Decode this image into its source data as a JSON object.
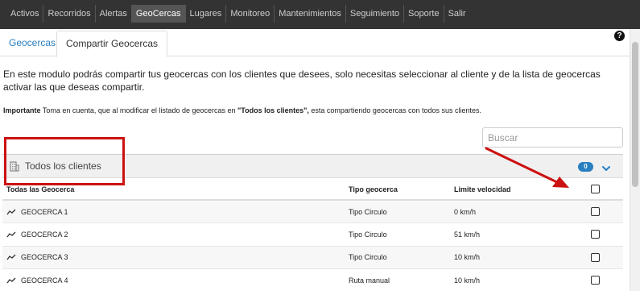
{
  "nav": {
    "items": [
      {
        "label": "Activos",
        "active": false
      },
      {
        "label": "Recorridos",
        "active": false
      },
      {
        "label": "Alertas",
        "active": false
      },
      {
        "label": "GeoCercas",
        "active": true
      },
      {
        "label": "Lugares",
        "active": false
      },
      {
        "label": "Monitoreo",
        "active": false
      },
      {
        "label": "Mantenimientos",
        "active": false
      },
      {
        "label": "Seguimiento",
        "active": false
      },
      {
        "label": "Soporte",
        "active": false
      },
      {
        "label": "Salir",
        "active": false
      }
    ]
  },
  "tabs": [
    {
      "label": "Geocercas",
      "active": false
    },
    {
      "label": "Compartir Geocercas",
      "active": true
    }
  ],
  "help_icon": "?",
  "intro": "En este modulo podrás compartir tus geocercas con los clientes que desees, solo necesitas seleccionar al cliente y de la lista de geocercas activar las que deseas compartir.",
  "note": {
    "label": "Importante",
    "text_before": " Toma en cuenta, que al modificar el listado de geocercas en ",
    "highlight": "\"Todos los clientes\",",
    "text_after": " esta compartiendo geocercas con todos sus clientes."
  },
  "search": {
    "placeholder": "Buscar",
    "value": ""
  },
  "client": {
    "label": "Todos los clientes",
    "count": "0",
    "icon": "building-icon",
    "expand_icon": "chevron-down-icon"
  },
  "table": {
    "headers": [
      "Todas las Geocerca",
      "Tipo geocerca",
      "Limite velocidad",
      ""
    ],
    "rows": [
      {
        "name": "GEOCERCA 1",
        "type": "Tipo Circulo",
        "speed": "0 km/h",
        "checked": false
      },
      {
        "name": "GEOCERCA 2",
        "type": "Tipo Circulo",
        "speed": "51 km/h",
        "checked": false
      },
      {
        "name": "GEOCERCA 3",
        "type": "Tipo Circulo",
        "speed": "10 km/h",
        "checked": false
      },
      {
        "name": "GEOCERCA 4",
        "type": "Ruta manual",
        "speed": "10 km/h",
        "checked": false
      }
    ]
  },
  "colors": {
    "nav_bg": "#333333",
    "accent": "#2a7fc1",
    "annotation": "#cc1111"
  }
}
